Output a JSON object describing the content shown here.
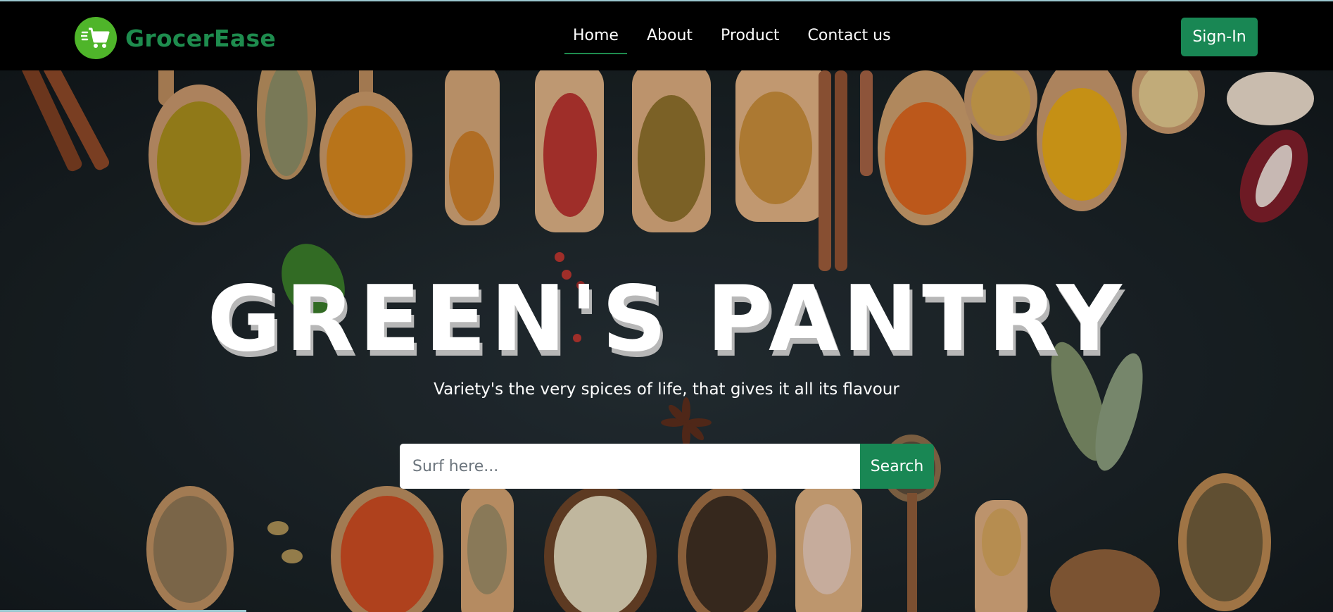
{
  "brand": {
    "name": "GrocerEase",
    "logo_icon": "shopping-cart-icon",
    "color": "#1e8c4e",
    "logo_bg": "#4fb52a"
  },
  "nav": {
    "items": [
      {
        "label": "Home",
        "active": true
      },
      {
        "label": "About",
        "active": false
      },
      {
        "label": "Product",
        "active": false
      },
      {
        "label": "Contact us",
        "active": false
      }
    ],
    "signin_label": "Sign-In"
  },
  "hero": {
    "title": "GREEN'S PANTRY",
    "subtitle": "Variety's the very spices of life, that gives it all its flavour",
    "search_placeholder": "Surf here...",
    "search_button": "Search",
    "background_image": "spices-in-wooden-spoons"
  },
  "colors": {
    "accent": "#198754",
    "navbar_bg": "#000000"
  }
}
